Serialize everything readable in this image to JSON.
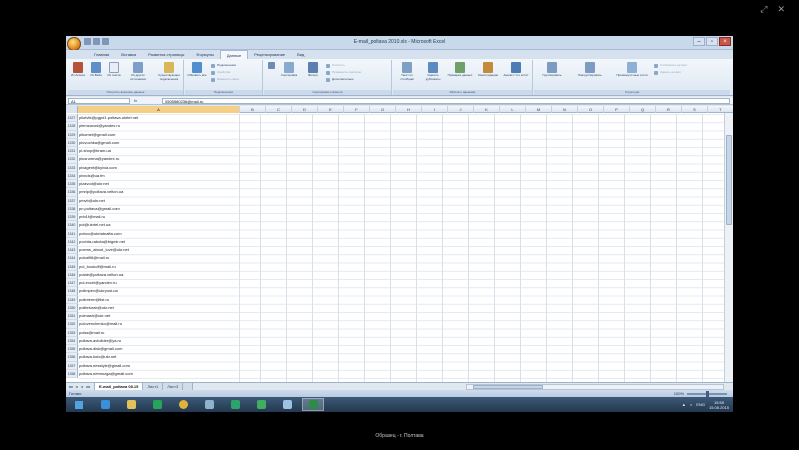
{
  "viewer": {
    "tools": [
      "⤢",
      "✕"
    ],
    "caption": "Образец - г. Полтава"
  },
  "window": {
    "title": "E-mail_poltava 2010.xls - Microsoft Excel",
    "controls": [
      "–",
      "▫",
      "×"
    ]
  },
  "ribbon": {
    "tabs": [
      "Главная",
      "Вставка",
      "Разметка страницы",
      "Формулы",
      "Данные",
      "Рецензирование",
      "Вид"
    ],
    "active_tab_index": 4,
    "groups": [
      {
        "label": "Получить внешние данные",
        "buttons": [
          "Из Access",
          "Из Веба",
          "Из текста",
          "Из других источников",
          "Существующие подключения"
        ]
      },
      {
        "label": "Подключения",
        "buttons": [
          "Обновить все"
        ],
        "small": [
          "Подключения",
          "Свойства",
          "Изменить связи"
        ]
      },
      {
        "label": "Сортировка и фильтр",
        "buttons": [
          "Сортировка",
          "Фильтр"
        ],
        "small": [
          "Очистить",
          "Применить повторно",
          "Дополнительно"
        ]
      },
      {
        "label": "Работа с данными",
        "buttons": [
          "Текст по столбцам",
          "Удалить дубликаты",
          "Проверка данных",
          "Консолидация",
          "Анализ \"что если\""
        ]
      },
      {
        "label": "Структура",
        "buttons": [
          "Группировать",
          "Разгруппировать",
          "Промежуточные итоги"
        ],
        "small": [
          "Отобразить детали",
          "Скрыть детали"
        ]
      }
    ]
  },
  "formula_bar": {
    "name_box": "A1",
    "fx": "fx",
    "value": "0505580236@mail.ru"
  },
  "grid": {
    "columns": [
      "A",
      "B",
      "C",
      "D",
      "E",
      "F",
      "G",
      "H",
      "I",
      "J",
      "K",
      "L",
      "M",
      "N",
      "O",
      "P",
      "Q",
      "R",
      "S",
      "T",
      "U",
      "V"
    ],
    "rows": [
      {
        "num": "1327",
        "a": "pilotvtk@pgpd1.poltava.ukrtel.net"
      },
      {
        "num": "1328",
        "a": "plemzavod@yandex.ru"
      },
      {
        "num": "1329",
        "a": "plkomet@gmail.com"
      },
      {
        "num": "1330",
        "a": "plovochka@gmail.com"
      },
      {
        "num": "1331",
        "a": "pl-shop@bram.ua"
      },
      {
        "num": "1332",
        "a": "plusnorma@yandex.ru"
      },
      {
        "num": "1333",
        "a": "plvagent@kyivia.com"
      },
      {
        "num": "1334",
        "a": "plvnds@ua.fm"
      },
      {
        "num": "1335",
        "a": "plzavod@ukr.net"
      },
      {
        "num": "1336",
        "a": "pmrlp@poltava.velton.ua"
      },
      {
        "num": "1337",
        "a": "pmvb@ukr.net"
      },
      {
        "num": "1338",
        "a": "pn.poltava@gmail.com"
      },
      {
        "num": "1339",
        "a": "pnb1f@mail.ru"
      },
      {
        "num": "1340",
        "a": "poi@ukrtel.net.ua"
      },
      {
        "num": "1341",
        "a": "pobov@ukrtatnafta.com"
      },
      {
        "num": "1342",
        "a": "pochta-rabota@bigmir.net"
      },
      {
        "num": "1343",
        "a": "poems_about_love@ukr.net"
      },
      {
        "num": "1344",
        "a": "pokat96@mail.ru"
      },
      {
        "num": "1345",
        "a": "pol_bookoff@mail.ru"
      },
      {
        "num": "1346",
        "a": "polatr@poltava.velton.ua"
      },
      {
        "num": "1347",
        "a": "pol-excel@yandex.ru"
      },
      {
        "num": "1348",
        "a": "polimpex@ukrpost.ua"
      },
      {
        "num": "1349",
        "a": "polinterm@list.ru"
      },
      {
        "num": "1350",
        "a": "politeturab@ukr.net"
      },
      {
        "num": "1351",
        "a": "polmash@ukr.net"
      },
      {
        "num": "1352",
        "a": "polovenchenko@mail.ru"
      },
      {
        "num": "1353",
        "a": "polss@mail.ru"
      },
      {
        "num": "1354",
        "a": "poltava.avtolider@ya.ru"
      },
      {
        "num": "1355",
        "a": "poltava.disk@gmail.com"
      },
      {
        "num": "1356",
        "a": "poltava.kolo@ukr.net"
      },
      {
        "num": "1357",
        "a": "poltava.nesstyle@gmail.com"
      },
      {
        "num": "1358",
        "a": "poltava.netmozga@gmail.com"
      }
    ]
  },
  "sheets": {
    "nav": [
      "◂◂",
      "◂",
      "▸",
      "▸▸"
    ],
    "tabs": [
      "E-mail_poltava 08.15",
      "Лист1",
      "Лист3"
    ],
    "active_index": 0
  },
  "status": {
    "text": "Готово",
    "zoom": "100%"
  },
  "taskbar": {
    "icons": [
      {
        "name": "windows-start-icon",
        "color": "#4fa3e0"
      },
      {
        "name": "ie-browser-icon",
        "color": "#3b8fd8"
      },
      {
        "name": "file-explorer-icon",
        "color": "#e2c15a"
      },
      {
        "name": "store-icon",
        "color": "#27a35a"
      },
      {
        "name": "chrome-icon",
        "color": "#e0b23a"
      },
      {
        "name": "network-icon",
        "color": "#8fb3cf"
      },
      {
        "name": "app-green-icon",
        "color": "#2ea36a"
      },
      {
        "name": "app-screen-icon",
        "color": "#3fae62"
      },
      {
        "name": "paint-icon",
        "color": "#9cc1e3"
      },
      {
        "name": "excel-icon",
        "color": "#2e8b4a"
      }
    ],
    "active_index": 9,
    "tray": {
      "lang": "ENG",
      "time": "15:55",
      "date": "15.08.2015"
    }
  }
}
